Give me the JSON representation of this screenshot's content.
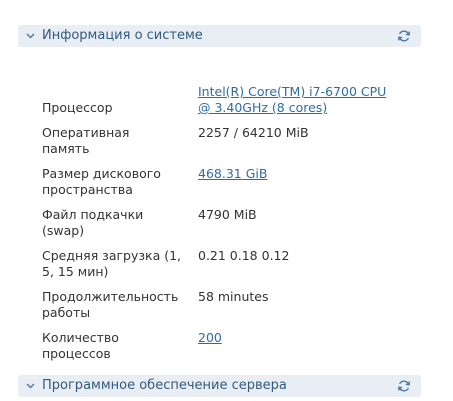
{
  "panels": {
    "system_info_title": "Информация о системе",
    "server_software_title": "Программное обеспечение сервера"
  },
  "rows": {
    "cpu": {
      "label": "Процессор",
      "value_line1": "Intel(R) Core(TM) i7-6700 CPU",
      "value_line2": "@ 3.40GHz (8 cores)"
    },
    "ram": {
      "label_line1": "Оперативная",
      "label_line2": "память",
      "value": "2257 / 64210 MiB"
    },
    "disk": {
      "label_line1": "Размер дискового",
      "label_line2": "пространства",
      "value": "468.31 GiB"
    },
    "swap": {
      "label_line1": "Файл подкачки",
      "label_line2": "(swap)",
      "value": "4790 MiB"
    },
    "load": {
      "label_line1": "Средняя загрузка (1,",
      "label_line2": "5, 15 мин)",
      "value": "0.21 0.18 0.12"
    },
    "uptime": {
      "label_line1": "Продолжительность",
      "label_line2": "работы",
      "value": "58 minutes"
    },
    "processes": {
      "label_line1": "Количество",
      "label_line2": "процессов",
      "value": "200"
    }
  },
  "icons": {
    "collapse": "chevron-down-icon",
    "refresh": "refresh-icon"
  },
  "colors": {
    "header_bg": "#e8eef3",
    "header_text": "#315a80",
    "link": "#2e6da4",
    "text": "#333333"
  }
}
